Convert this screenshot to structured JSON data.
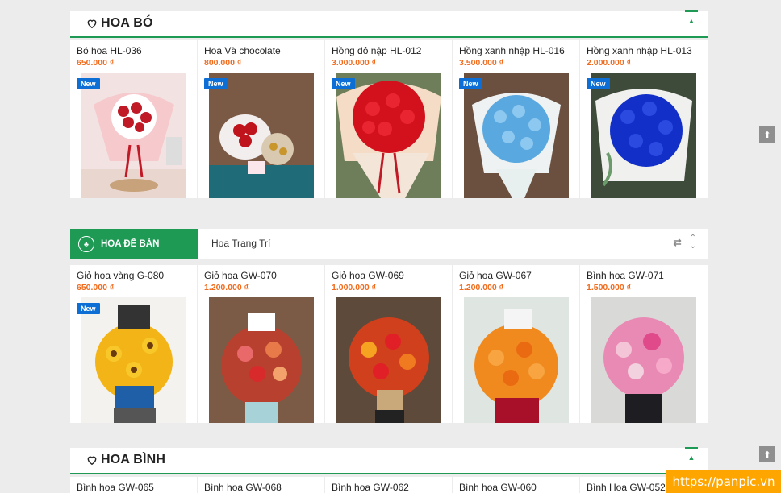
{
  "sections": {
    "hoa_bo": {
      "title": "HOA BÓ",
      "toggle": "▲"
    },
    "hoa_binh": {
      "title": "HOA BÌNH",
      "toggle": "▲"
    }
  },
  "hoa_bo_products": [
    {
      "name": "Bó hoa HL-036",
      "price": "650.000 ₫",
      "badge": "New"
    },
    {
      "name": "Hoa Và chocolate",
      "price": "800.000 ₫",
      "badge": "New"
    },
    {
      "name": "Hồng đỏ nập HL-012",
      "price": "3.000.000 ₫",
      "badge": "New"
    },
    {
      "name": "Hồng xanh nhập HL-016",
      "price": "3.500.000 ₫",
      "badge": "New"
    },
    {
      "name": "Hồng xanh nhập HL-013",
      "price": "2.000.000 ₫",
      "badge": "New"
    }
  ],
  "tabs": {
    "active": "HOA ĐẾ BÀN",
    "other": "Hoa Trang Trí",
    "swap_icon": "⇄",
    "up": "⌃",
    "down": "⌄"
  },
  "de_ban_products": [
    {
      "name": "Giỏ hoa vàng G-080",
      "price": "650.000 ₫",
      "badge": "New"
    },
    {
      "name": "Giỏ hoa GW-070",
      "price": "1.200.000 ₫"
    },
    {
      "name": "Giỏ hoa GW-069",
      "price": "1.000.000 ₫"
    },
    {
      "name": "Giỏ hoa GW-067",
      "price": "1.200.000 ₫"
    },
    {
      "name": "Bình hoa GW-071",
      "price": "1.500.000 ₫"
    }
  ],
  "hoa_binh_products": [
    {
      "name": "Bình hoa GW-065"
    },
    {
      "name": "Bình hoa GW-068"
    },
    {
      "name": "Bình hoa GW-062"
    },
    {
      "name": "Bình hoa GW-060"
    },
    {
      "name": "Bình Hoa GW-052"
    }
  ],
  "scroll_top": "⬆",
  "watermark": "https://panpic.vn",
  "colors": {
    "accent": "#1e9a55",
    "price": "#f26b1d",
    "badge": "#0d6fd6"
  }
}
